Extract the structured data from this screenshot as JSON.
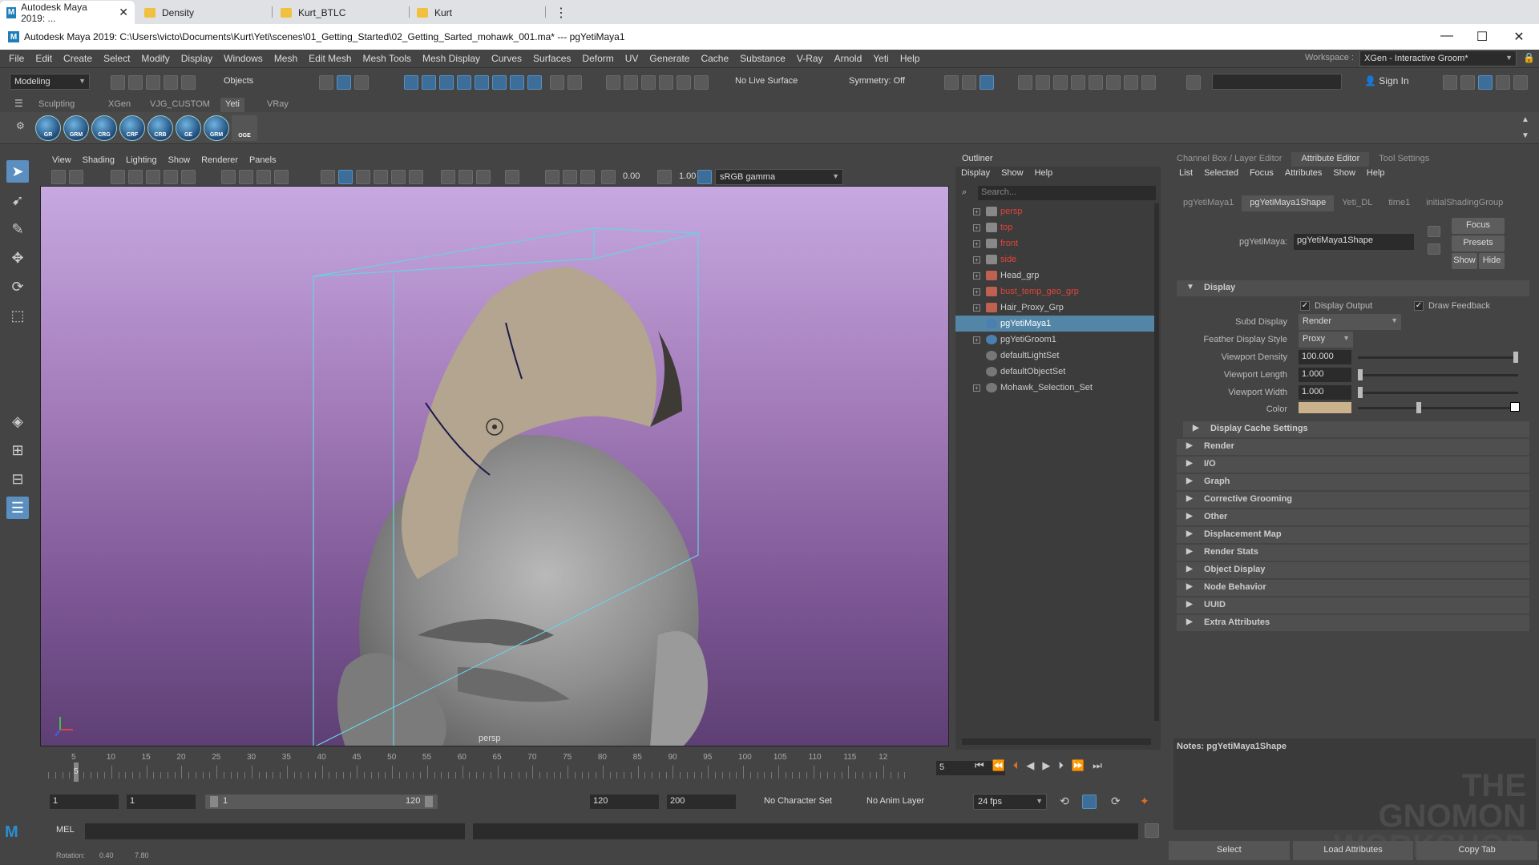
{
  "browser": {
    "tabs": [
      {
        "label": "Autodesk Maya 2019: ..."
      },
      {
        "label": "Density"
      },
      {
        "label": "Kurt_BTLC"
      },
      {
        "label": "Kurt"
      }
    ]
  },
  "window": {
    "title": "Autodesk Maya 2019: C:\\Users\\victo\\Documents\\Kurt\\Yeti\\scenes\\01_Getting_Started\\02_Getting_Sarted_mohawk_001.ma*  ---  pgYetiMaya1"
  },
  "menubar": {
    "items": [
      "File",
      "Edit",
      "Create",
      "Select",
      "Modify",
      "Display",
      "Windows",
      "Mesh",
      "Edit Mesh",
      "Mesh Tools",
      "Mesh Display",
      "Curves",
      "Surfaces",
      "Deform",
      "UV",
      "Generate",
      "Cache",
      "Substance",
      "V-Ray",
      "Arnold",
      "Yeti",
      "Help"
    ],
    "workspace_label": "Workspace :",
    "workspace_value": "XGen - Interactive Groom*"
  },
  "statusline": {
    "mode": "Modeling",
    "select_mode": "Objects",
    "live_surface": "No Live Surface",
    "symmetry": "Symmetry: Off",
    "sign_in": "Sign In"
  },
  "shelf": {
    "tabs": [
      "Sculpting",
      "XGen",
      "VJG_CUSTOM",
      "Yeti",
      "VRay"
    ],
    "active_tab": "Yeti",
    "icons": [
      "GR",
      "GRM",
      "CRG",
      "CRF",
      "CRB",
      "GE",
      "GRM",
      "OGE"
    ]
  },
  "viewport": {
    "menu": [
      "View",
      "Shading",
      "Lighting",
      "Show",
      "Renderer",
      "Panels"
    ],
    "exposure": "0.00",
    "gamma": "1.00",
    "color_space": "sRGB gamma",
    "camera_label": "persp"
  },
  "outliner": {
    "title": "Outliner",
    "menu": [
      "Display",
      "Show",
      "Help"
    ],
    "search_placeholder": "Search...",
    "items": [
      {
        "label": "persp",
        "color": "#e0443a",
        "expand": true,
        "icon": "camera-icon"
      },
      {
        "label": "top",
        "color": "#e0443a",
        "expand": true,
        "icon": "camera-icon"
      },
      {
        "label": "front",
        "color": "#e0443a",
        "expand": true,
        "icon": "camera-icon"
      },
      {
        "label": "side",
        "color": "#e0443a",
        "expand": true,
        "icon": "camera-icon"
      },
      {
        "label": "Head_grp",
        "color": "#cccccc",
        "expand": true,
        "icon": "transform-icon"
      },
      {
        "label": "bust_temp_geo_grp",
        "color": "#e0443a",
        "expand": true,
        "icon": "transform-icon"
      },
      {
        "label": "Hair_Proxy_Grp",
        "color": "#cccccc",
        "expand": true,
        "icon": "transform-icon"
      },
      {
        "label": "pgYetiMaya1",
        "color": "#ffffff",
        "expand": false,
        "icon": "yeti-node-icon",
        "selected": true
      },
      {
        "label": "pgYetiGroom1",
        "color": "#cccccc",
        "expand": true,
        "icon": "groom-icon"
      },
      {
        "label": "defaultLightSet",
        "color": "#cccccc",
        "expand": false,
        "icon": "set-icon"
      },
      {
        "label": "defaultObjectSet",
        "color": "#cccccc",
        "expand": false,
        "icon": "set-icon"
      },
      {
        "label": "Mohawk_Selection_Set",
        "color": "#cccccc",
        "expand": true,
        "icon": "set-icon"
      }
    ]
  },
  "attribute_editor": {
    "panel_tabs": [
      "Channel Box / Layer Editor",
      "Attribute Editor",
      "Tool Settings"
    ],
    "active_panel_tab": "Attribute Editor",
    "menu": [
      "List",
      "Selected",
      "Focus",
      "Attributes",
      "Show",
      "Help"
    ],
    "node_tabs": [
      "pgYetiMaya1",
      "pgYetiMaya1Shape",
      "Yeti_DL",
      "time1",
      "initialShadingGroup"
    ],
    "active_node_tab": "pgYetiMaya1Shape",
    "node_type_label": "pgYetiMaya:",
    "node_name": "pgYetiMaya1Shape",
    "buttons": {
      "focus": "Focus",
      "presets": "Presets",
      "show": "Show",
      "hide": "Hide"
    },
    "display": {
      "title": "Display",
      "display_output_label": "Display Output",
      "display_output": true,
      "draw_feedback_label": "Draw Feedback",
      "draw_feedback": true,
      "subd_display_label": "Subd Display",
      "subd_display": "Render",
      "feather_style_label": "Feather Display Style",
      "feather_style": "Proxy",
      "viewport_density_label": "Viewport Density",
      "viewport_density": "100.000",
      "viewport_density_level": 1.0,
      "viewport_length_label": "Viewport Length",
      "viewport_length": "1.000",
      "viewport_length_level": 0.0,
      "viewport_width_label": "Viewport Width",
      "viewport_width": "1.000",
      "viewport_width_level": 0.0,
      "color_label": "Color",
      "color_value": "#c9b28c",
      "color_level": 0.38
    },
    "sections": [
      "Display Cache Settings",
      "Render",
      "I/O",
      "Graph",
      "Corrective Grooming",
      "Other",
      "Displacement Map",
      "Render Stats",
      "Object Display",
      "Node Behavior",
      "UUID",
      "Extra Attributes"
    ],
    "notes_label": "Notes:  pgYetiMaya1Shape",
    "bottom_buttons": [
      "Select",
      "Load Attributes",
      "Copy Tab"
    ],
    "watermark": "THE GNOMON WORKSHOP"
  },
  "timeline": {
    "ticks": [
      5,
      10,
      15,
      20,
      25,
      30,
      35,
      40,
      45,
      50,
      55,
      60,
      65,
      70,
      75,
      80,
      85,
      90,
      95,
      100,
      105,
      110,
      115,
      12
    ],
    "current_frame": "5",
    "playhead_frame": 5,
    "playhead_label": "5"
  },
  "range": {
    "start": "1",
    "playback_start": "1",
    "range_start": "1",
    "range_end": "120",
    "playback_end": "120",
    "end": "200",
    "character_set": "No Character Set",
    "anim_layer": "No Anim Layer",
    "fps": "24 fps"
  },
  "command": {
    "lang": "MEL"
  },
  "help": {
    "label": "Rotation:",
    "value_a": "0.40",
    "value_b": "7.80"
  }
}
